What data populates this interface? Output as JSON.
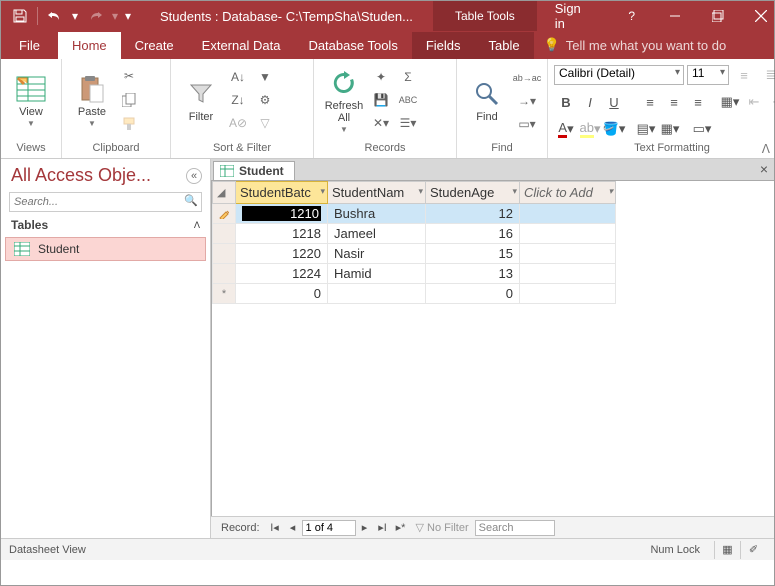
{
  "titlebar": {
    "title": "Students : Database- C:\\TempSha\\Studen...",
    "contextual": "Table Tools",
    "signin": "Sign in"
  },
  "tabs": {
    "file": "File",
    "home": "Home",
    "create": "Create",
    "external": "External Data",
    "dbtools": "Database Tools",
    "fields": "Fields",
    "table": "Table",
    "tellme": "Tell me what you want to do"
  },
  "ribbon": {
    "view": "View",
    "paste": "Paste",
    "filter": "Filter",
    "refresh": "Refresh\nAll",
    "find": "Find",
    "groups": {
      "views": "Views",
      "clipboard": "Clipboard",
      "sortfilter": "Sort & Filter",
      "records": "Records",
      "find": "Find",
      "textfmt": "Text Formatting"
    },
    "font": {
      "name": "Calibri (Detail)",
      "size": "11"
    }
  },
  "nav": {
    "title": "All Access Obje...",
    "search_ph": "Search...",
    "tables": "Tables",
    "item1": "Student"
  },
  "doc": {
    "tab": "Student",
    "columns": {
      "c1": "StudentBatc",
      "c2": "StudentNam",
      "c3": "StudenAge",
      "add": "Click to Add"
    },
    "rows": [
      {
        "batch": "1210",
        "name": "Bushra",
        "age": "12"
      },
      {
        "batch": "1218",
        "name": "Jameel",
        "age": "16"
      },
      {
        "batch": "1220",
        "name": "Nasir",
        "age": "15"
      },
      {
        "batch": "1224",
        "name": "Hamid",
        "age": "13"
      }
    ],
    "newrow": {
      "batch": "0",
      "age": "0"
    }
  },
  "recnav": {
    "label": "Record:",
    "pos": "1 of 4",
    "nofilter": "No Filter",
    "search": "Search"
  },
  "status": {
    "left": "Datasheet View",
    "numlock": "Num Lock"
  }
}
